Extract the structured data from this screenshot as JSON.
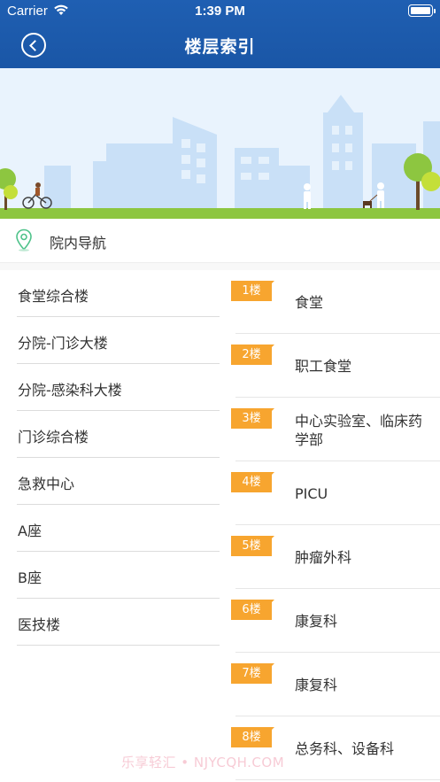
{
  "status_bar": {
    "carrier": "Carrier",
    "time": "1:39 PM"
  },
  "navbar": {
    "title": "楼层索引"
  },
  "indoor_nav": {
    "label": "院内导航"
  },
  "buildings": [
    {
      "label": "食堂综合楼"
    },
    {
      "label": "分院-门诊大楼"
    },
    {
      "label": "分院-感染科大楼"
    },
    {
      "label": "门诊综合楼"
    },
    {
      "label": "急救中心"
    },
    {
      "label": "A座"
    },
    {
      "label": "B座"
    },
    {
      "label": "医技楼"
    }
  ],
  "floors": [
    {
      "floor": "1楼",
      "name": "食堂"
    },
    {
      "floor": "2楼",
      "name": "职工食堂"
    },
    {
      "floor": "3楼",
      "name": "中心实验室、临床药学部"
    },
    {
      "floor": "4楼",
      "name": "PICU"
    },
    {
      "floor": "5楼",
      "name": "肿瘤外科"
    },
    {
      "floor": "6楼",
      "name": "康复科"
    },
    {
      "floor": "7楼",
      "name": "康复科"
    },
    {
      "floor": "8楼",
      "name": "总务科、设备科"
    }
  ],
  "watermark": "乐享轻汇 • NJYCQH.COM",
  "colors": {
    "header": "#1f5fb2",
    "badge": "#f7a52f",
    "pin": "#4ec28a"
  }
}
